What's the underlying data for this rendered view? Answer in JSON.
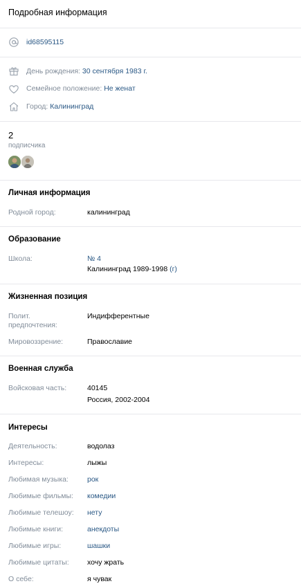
{
  "header": {
    "title": "Подробная информация"
  },
  "contact": {
    "id": "id68595115"
  },
  "main_info": {
    "birthday_label": "День рождения:",
    "birthday_value": "30 сентября 1983 г.",
    "family_label": "Семейное положение:",
    "family_value": "Не женат",
    "city_label": "Город:",
    "city_value": "Калининград"
  },
  "followers": {
    "count": "2",
    "label": "подписчика"
  },
  "personal": {
    "title": "Личная информация",
    "hometown_label": "Родной город:",
    "hometown_value": "калининград"
  },
  "education": {
    "title": "Образование",
    "school_label": "Школа:",
    "school_name": "№ 4",
    "school_detail": "Калининград 1989-1998",
    "school_detail_link": "(г)"
  },
  "position": {
    "title": "Жизненная позиция",
    "politics_label_line1": "Полит.",
    "politics_label_line2": "предпочтения:",
    "politics_value": "Индифферентные",
    "worldview_label": "Мировоззрение:",
    "worldview_value": "Православие"
  },
  "military": {
    "title": "Военная служба",
    "unit_label": "Войсковая часть:",
    "unit_value": "40145",
    "unit_detail": "Россия, 2002-2004"
  },
  "interests": {
    "title": "Интересы",
    "rows": [
      {
        "label": "Деятельность:",
        "value": "водолаз"
      },
      {
        "label": "Интересы:",
        "value": "лыжы"
      },
      {
        "label": "Любимая музыка:",
        "value": "рок"
      },
      {
        "label": "Любимые фильмы:",
        "value": "комедии"
      },
      {
        "label": "Любимые телешоу:",
        "value": "нету"
      },
      {
        "label": "Любимые книги:",
        "value": "анекдоты"
      },
      {
        "label": "Любимые игры:",
        "value": "шашки"
      },
      {
        "label": "Любимые цитаты:",
        "value": "хочу жрать"
      },
      {
        "label": "О себе:",
        "value": "я чувак"
      }
    ]
  },
  "colors": {
    "link": "#2a5885",
    "label": "#818c99",
    "divider": "#e7e8ec",
    "icon": "#99a2ad"
  }
}
